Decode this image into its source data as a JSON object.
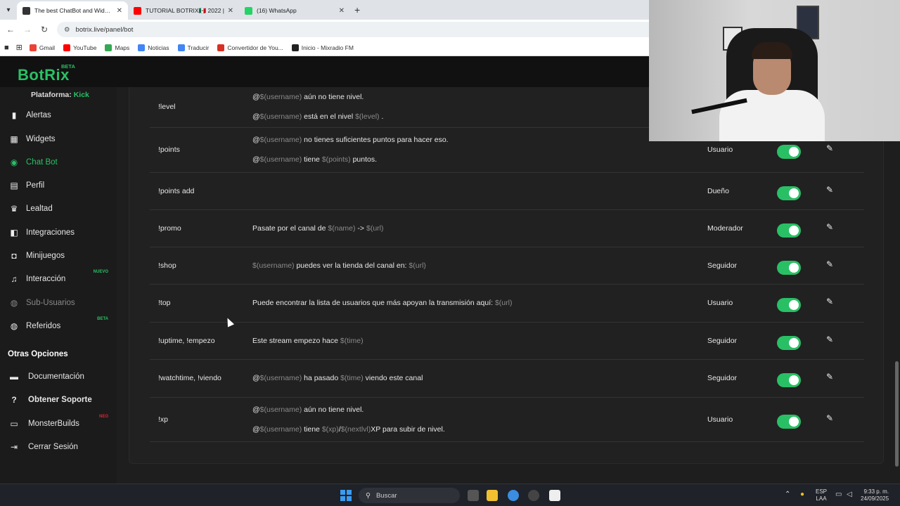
{
  "browser": {
    "tabs": [
      {
        "title": "The best ChatBot and Widgets",
        "active": true,
        "color": "#333333"
      },
      {
        "title": "TUTORIAL BOTRIX🇲🇽 2022 | ",
        "active": false,
        "color": "#ff0000"
      },
      {
        "title": "(16) WhatsApp",
        "active": false,
        "color": "#25d366"
      }
    ],
    "url": "botrix.live/panel/bot",
    "bookmarks": [
      {
        "label": "Gmail",
        "color": "#ea4335"
      },
      {
        "label": "YouTube",
        "color": "#ff0000"
      },
      {
        "label": "Maps",
        "color": "#34a853"
      },
      {
        "label": "Noticias",
        "color": "#4285f4"
      },
      {
        "label": "Traducir",
        "color": "#4285f4"
      },
      {
        "label": "Convertidor de You...",
        "color": "#d93025"
      },
      {
        "label": "Inicio - Mixradio FM",
        "color": "#222222"
      }
    ]
  },
  "app": {
    "logo": "BotRix",
    "logo_beta": "BETA",
    "accent": "#29c065",
    "platform_label": "Plataforma:",
    "platform_value": "Kick"
  },
  "sidebar": {
    "items": [
      {
        "label": "Alertas",
        "icon": "bell-icon",
        "state": "normal"
      },
      {
        "label": "Widgets",
        "icon": "grid-icon",
        "state": "normal"
      },
      {
        "label": "Chat Bot",
        "icon": "robot-icon",
        "state": "active"
      },
      {
        "label": "Perfil",
        "icon": "id-card-icon",
        "state": "normal"
      },
      {
        "label": "Lealtad",
        "icon": "trophy-icon",
        "state": "normal"
      },
      {
        "label": "Integraciones",
        "icon": "puzzle-icon",
        "state": "normal"
      },
      {
        "label": "Minijuegos",
        "icon": "gamepad-icon",
        "state": "normal"
      },
      {
        "label": "Interacción",
        "icon": "music-icon",
        "state": "normal",
        "badge": "NUEVO"
      },
      {
        "label": "Sub-Usuarios",
        "icon": "users-icon",
        "state": "disabled"
      },
      {
        "label": "Referidos",
        "icon": "user-group-icon",
        "state": "normal",
        "badge": "BETA"
      }
    ],
    "other_title": "Otras Opciones",
    "other_items": [
      {
        "label": "Documentación",
        "icon": "book-icon",
        "bold": false
      },
      {
        "label": "Obtener Soporte",
        "icon": "help-icon",
        "bold": true
      },
      {
        "label": "MonsterBuilds",
        "icon": "monitor-icon",
        "bold": false,
        "badge": "NEO"
      },
      {
        "label": "Cerrar Sesión",
        "icon": "logout-icon",
        "bold": false
      }
    ]
  },
  "commands": [
    {
      "name": "!level",
      "lines": [
        [
          {
            "t": "@"
          },
          {
            "t": "$(username)",
            "v": true
          },
          {
            "t": " aún no tiene nivel."
          }
        ],
        [
          {
            "t": "@"
          },
          {
            "t": "$(username)",
            "v": true
          },
          {
            "t": " está en el nivel "
          },
          {
            "t": "$(level)",
            "v": true
          },
          {
            "t": " ."
          }
        ]
      ],
      "role": ""
    },
    {
      "name": "!points",
      "lines": [
        [
          {
            "t": "@"
          },
          {
            "t": "$(username)",
            "v": true
          },
          {
            "t": " no tienes suficientes puntos para hacer eso."
          }
        ],
        [
          {
            "t": "@"
          },
          {
            "t": "$(username)",
            "v": true
          },
          {
            "t": " tiene "
          },
          {
            "t": "$(points)",
            "v": true
          },
          {
            "t": " puntos."
          }
        ]
      ],
      "role": "Usuario"
    },
    {
      "name": "!points add",
      "lines": [],
      "role": "Dueño"
    },
    {
      "name": "!promo",
      "lines": [
        [
          {
            "t": "Pasate por el canal de "
          },
          {
            "t": "$(name)",
            "v": true
          },
          {
            "t": " -> "
          },
          {
            "t": "$(url)",
            "v": true
          }
        ]
      ],
      "role": "Moderador"
    },
    {
      "name": "!shop",
      "lines": [
        [
          {
            "t": "$(username)",
            "v": true
          },
          {
            "t": " puedes ver la tienda del canal en: "
          },
          {
            "t": "$(url)",
            "v": true
          }
        ]
      ],
      "role": "Seguidor"
    },
    {
      "name": "!top",
      "lines": [
        [
          {
            "t": "Puede encontrar la lista de usuarios que más apoyan la transmisión aquí: "
          },
          {
            "t": "$(url)",
            "v": true
          }
        ]
      ],
      "role": "Usuario"
    },
    {
      "name": "!uptime, !empezo",
      "lines": [
        [
          {
            "t": "Este stream empezo hace "
          },
          {
            "t": "$(time)",
            "v": true
          }
        ]
      ],
      "role": "Seguidor"
    },
    {
      "name": "!watchtime, !viendo",
      "lines": [
        [
          {
            "t": "@"
          },
          {
            "t": "$(username)",
            "v": true
          },
          {
            "t": " ha pasado "
          },
          {
            "t": "$(time)",
            "v": true
          },
          {
            "t": " viendo este canal"
          }
        ]
      ],
      "role": "Seguidor"
    },
    {
      "name": "!xp",
      "lines": [
        [
          {
            "t": "@"
          },
          {
            "t": "$(username)",
            "v": true
          },
          {
            "t": " aún no tiene nivel."
          }
        ],
        [
          {
            "t": "@"
          },
          {
            "t": "$(username)",
            "v": true
          },
          {
            "t": " tiene "
          },
          {
            "t": "$(xp)",
            "v": true
          },
          {
            "t": "/"
          },
          {
            "t": "$(nextlvl)",
            "v": true
          },
          {
            "t": "XP para subir de nivel."
          }
        ]
      ],
      "role": "Usuario"
    }
  ],
  "taskbar": {
    "search_placeholder": "Buscar",
    "lang_top": "ESP",
    "lang_bottom": "LAA",
    "time": "9:33 p. m.",
    "date": "24/09/2025"
  }
}
